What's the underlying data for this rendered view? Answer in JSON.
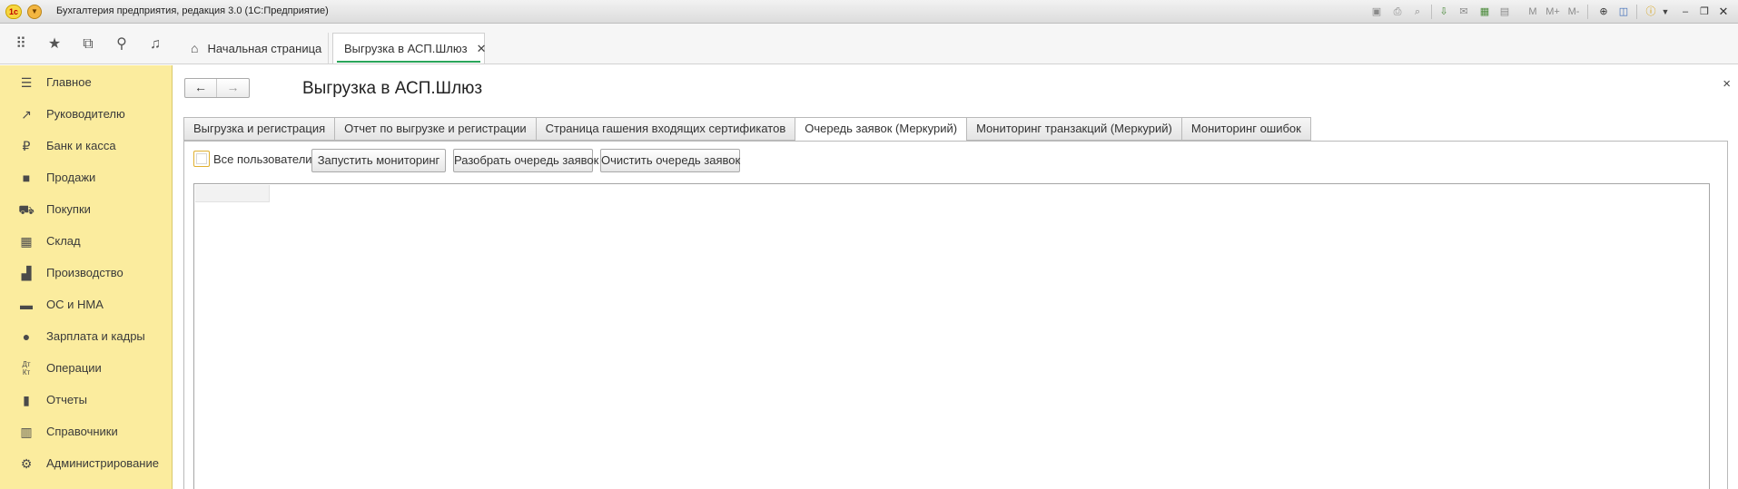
{
  "window": {
    "title": "Бухгалтерия предприятия, редакция 3.0  (1С:Предприятие)",
    "logo_text": "1c",
    "memory_labels": [
      "M",
      "M+",
      "M-"
    ]
  },
  "nav": {
    "tabs": [
      {
        "label": "Начальная страница",
        "icon": "home-icon"
      },
      {
        "label": "Выгрузка в АСП.Шлюз",
        "icon": "close-icon"
      }
    ]
  },
  "sidebar": {
    "items": [
      {
        "label": "Главное",
        "icon": "menu-lines-icon"
      },
      {
        "label": "Руководителю",
        "icon": "trend-icon"
      },
      {
        "label": "Банк и касса",
        "icon": "ruble-icon"
      },
      {
        "label": "Продажи",
        "icon": "shopping-bag-icon"
      },
      {
        "label": "Покупки",
        "icon": "cart-icon"
      },
      {
        "label": "Склад",
        "icon": "warehouse-icon"
      },
      {
        "label": "Производство",
        "icon": "factory-icon"
      },
      {
        "label": "ОС и НМА",
        "icon": "truck-icon"
      },
      {
        "label": "Зарплата и кадры",
        "icon": "person-icon"
      },
      {
        "label": "Операции",
        "icon": "debit-credit-icon"
      },
      {
        "label": "Отчеты",
        "icon": "bar-chart-icon"
      },
      {
        "label": "Справочники",
        "icon": "books-icon"
      },
      {
        "label": "Администрирование",
        "icon": "gear-icon"
      }
    ]
  },
  "form": {
    "title": "Выгрузка в АСП.Шлюз",
    "close_glyph": "×",
    "tabs": [
      "Выгрузка и регистрация",
      "Отчет по выгрузке и регистрации",
      "Страница гашения входящих сертификатов",
      "Очередь заявок (Меркурий)",
      "Мониторинг транзакций (Меркурий)",
      "Мониторинг ошибок"
    ],
    "active_tab_index": 3,
    "all_users_label": "Все пользователи",
    "all_users_checked": false,
    "buttons": {
      "start_monitoring": "Запустить мониторинг",
      "parse_queue": "Разобрать очередь заявок",
      "clear_queue": "Очистить очередь заявок"
    }
  },
  "colors": {
    "sidebar_bg": "#fbec9e",
    "active_tab_accent": "#2aa55a"
  }
}
